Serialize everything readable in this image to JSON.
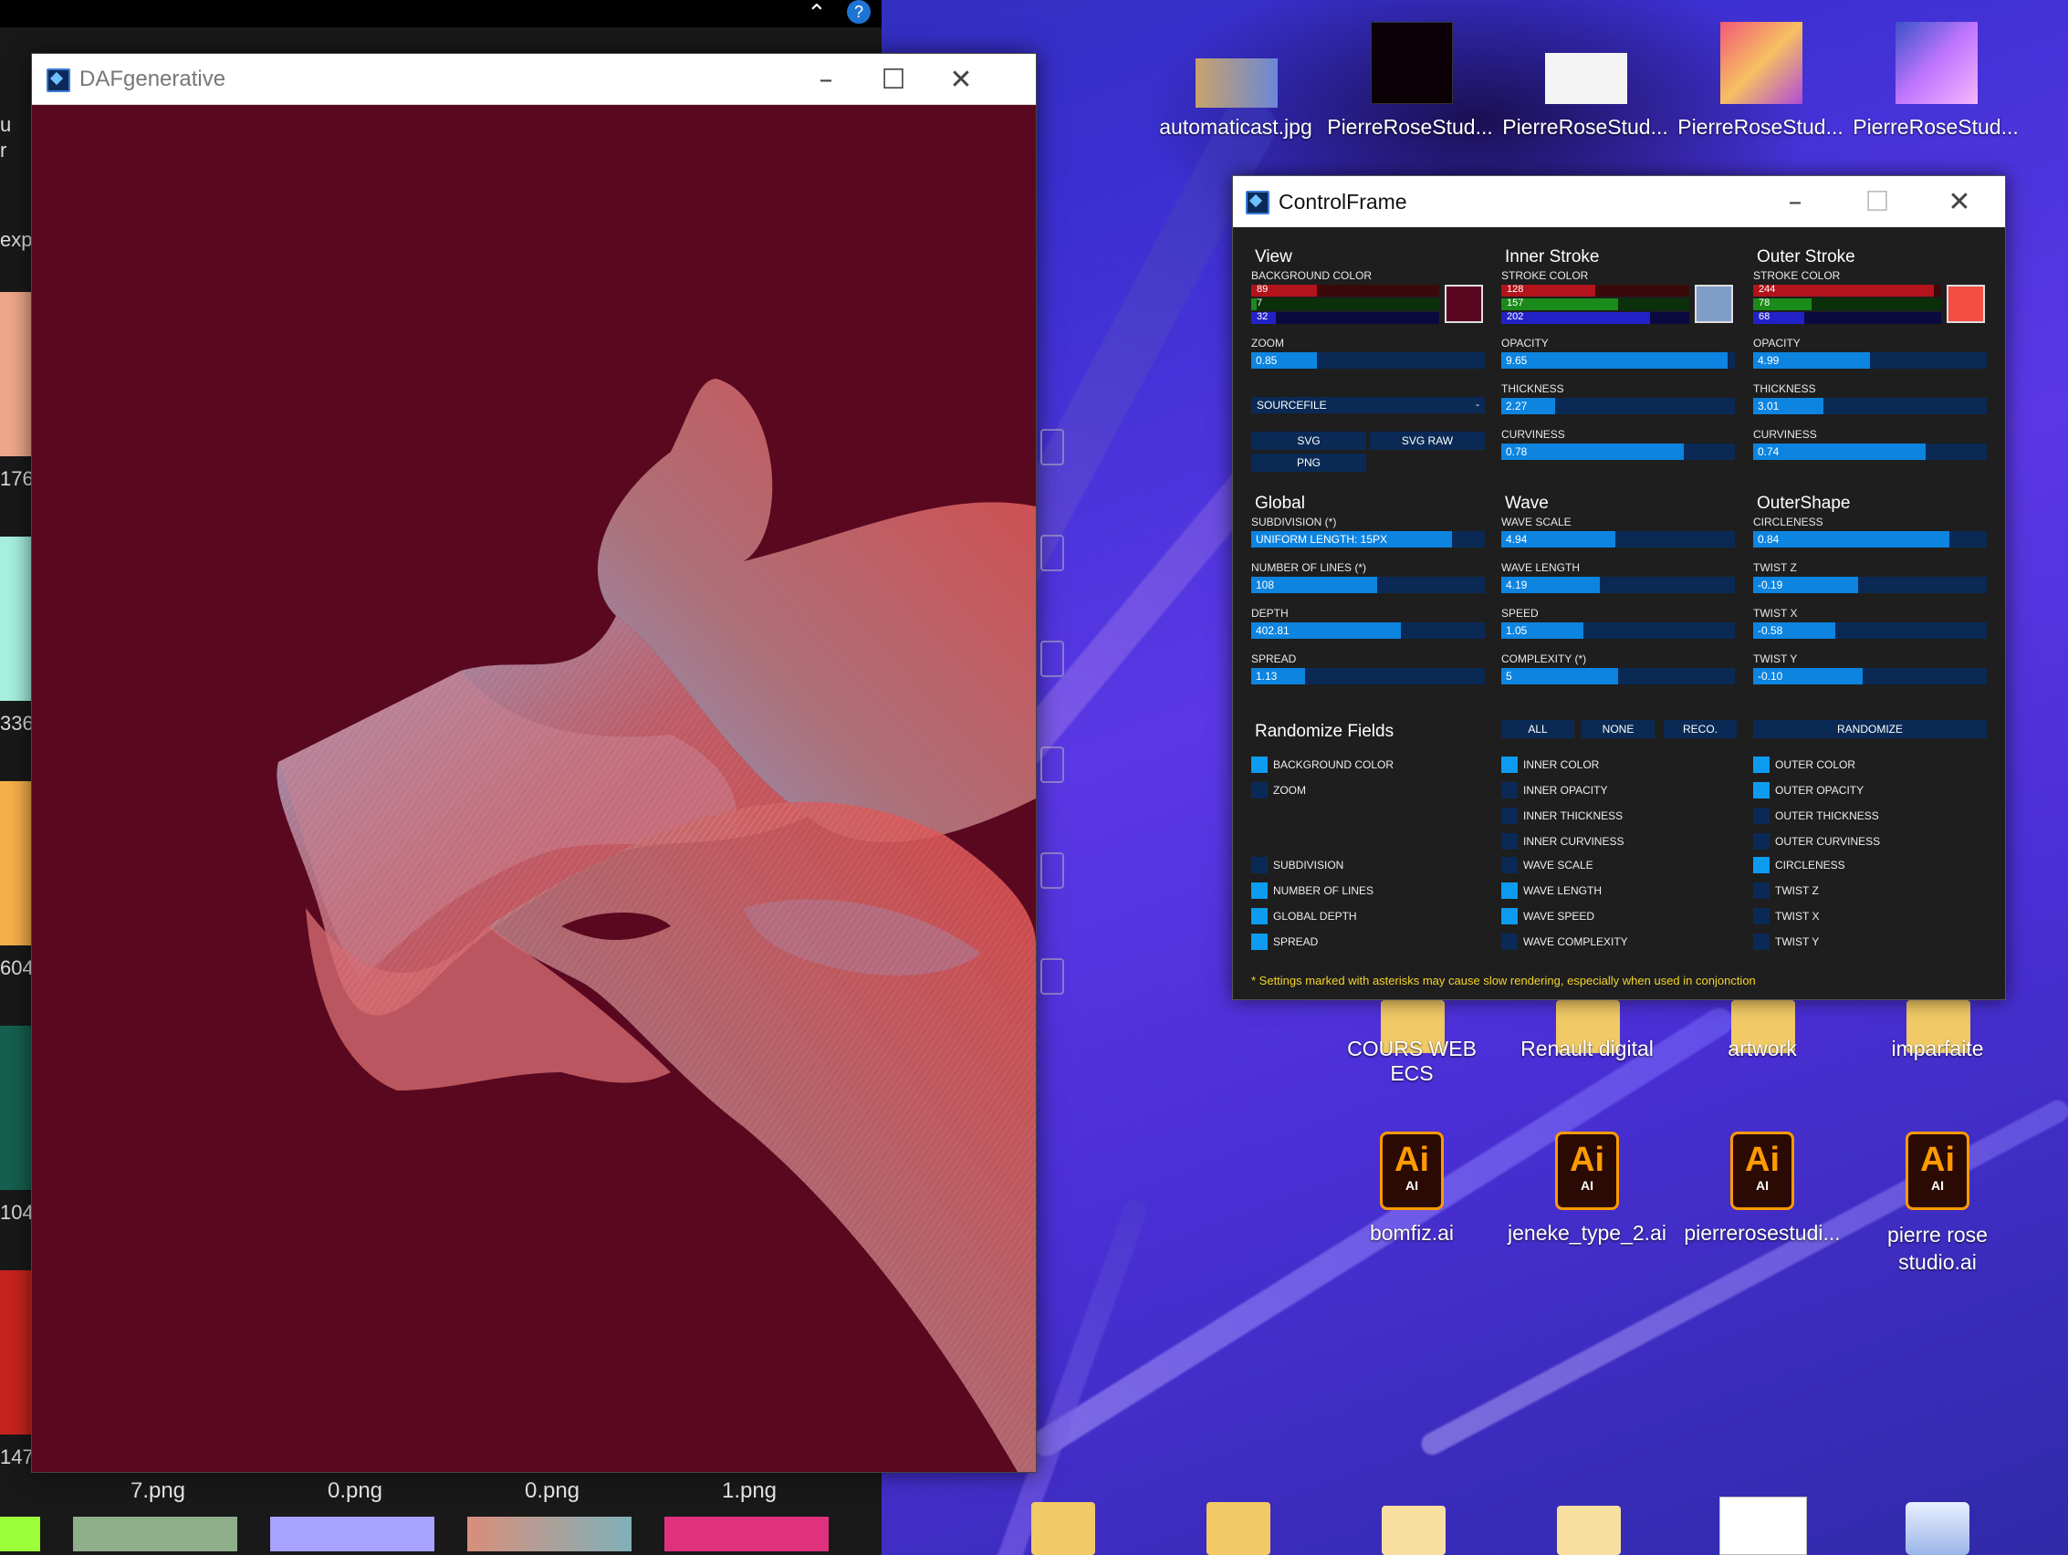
{
  "explorer": {
    "side_labels": [
      "u",
      "r",
      "exp",
      "176",
      "336",
      "604",
      "104",
      "147"
    ],
    "bottom_files": [
      "7.png",
      "0.png",
      "0.png",
      "1.png"
    ]
  },
  "daf_window": {
    "title": "DAFgenerative",
    "background_color": "#5a0820"
  },
  "desktop": {
    "top_icons": [
      "automaticast.jpg",
      "PierreRoseStud...",
      "PierreRoseStud...",
      "PierreRoseStud...",
      "PierreRoseStud..."
    ],
    "folder_icons": [
      "COURS WEB ECS",
      "Renault digital",
      "artwork",
      "imparfaite"
    ],
    "ai_icons": [
      "bomfiz.ai",
      "jeneke_type_2.ai",
      "pierrerosestudi...",
      "pierre rose studio.ai"
    ],
    "ai_badge": "Ai",
    "ai_sub": "AI"
  },
  "control_frame": {
    "title": "ControlFrame",
    "view": {
      "heading": "View",
      "bg_label": "BACKGROUND COLOR",
      "r": "89",
      "g": "7",
      "b": "32",
      "r_level": 0.35,
      "g_level": 0.03,
      "b_level": 0.13,
      "swatch": "#590720",
      "zoom_label": "ZOOM",
      "zoom": "0.85",
      "zoom_level": 0.28,
      "sourcefile": "SOURCEFILE",
      "sourcefile_arrow": "-",
      "svg": "SVG",
      "svg_raw": "SVG RAW",
      "png": "PNG"
    },
    "inner": {
      "heading": "Inner Stroke",
      "color_label": "STROKE COLOR",
      "r": "128",
      "g": "157",
      "b": "202",
      "r_level": 0.5,
      "g_level": 0.62,
      "b_level": 0.79,
      "swatch": "#809dca",
      "opacity_label": "OPACITY",
      "opacity": "9.65",
      "opacity_level": 0.97,
      "thickness_label": "THICKNESS",
      "thickness": "2.27",
      "thickness_level": 0.23,
      "curviness_label": "CURVINESS",
      "curviness": "0.78",
      "curviness_level": 0.78
    },
    "outer": {
      "heading": "Outer Stroke",
      "color_label": "STROKE COLOR",
      "r": "244",
      "g": "78",
      "b": "68",
      "r_level": 0.96,
      "g_level": 0.31,
      "b_level": 0.27,
      "swatch": "#f44e44",
      "opacity_label": "OPACITY",
      "opacity": "4.99",
      "opacity_level": 0.5,
      "thickness_label": "THICKNESS",
      "thickness": "3.01",
      "thickness_level": 0.3,
      "curviness_label": "CURVINESS",
      "curviness": "0.74",
      "curviness_level": 0.74
    },
    "global": {
      "heading": "Global",
      "subdivision_label": "SUBDIVISION (*)",
      "subdivision": "UNIFORM LENGTH: 15PX",
      "subdivision_level": 0.86,
      "lines_label": "NUMBER OF LINES (*)",
      "lines": "108",
      "lines_level": 0.54,
      "depth_label": "DEPTH",
      "depth": "402.81",
      "depth_level": 0.64,
      "spread_label": "SPREAD",
      "spread": "1.13",
      "spread_level": 0.23
    },
    "wave": {
      "heading": "Wave",
      "scale_label": "WAVE SCALE",
      "scale": "4.94",
      "scale_level": 0.49,
      "length_label": "WAVE LENGTH",
      "length": "4.19",
      "length_level": 0.42,
      "speed_label": "SPEED",
      "speed": "1.05",
      "speed_level": 0.35,
      "complexity_label": "COMPLEXITY (*)",
      "complexity": "5",
      "complexity_level": 0.5
    },
    "outershape": {
      "heading": "OuterShape",
      "circleness_label": "CIRCLENESS",
      "circleness": "0.84",
      "circleness_level": 0.84,
      "twistz_label": "TWIST Z",
      "twistz": "-0.19",
      "twistz_level": 0.45,
      "twistx_label": "TWIST X",
      "twistx": "-0.58",
      "twistx_level": 0.35,
      "twisty_label": "TWIST Y",
      "twisty": "-0.10",
      "twisty_level": 0.47
    },
    "randomize": {
      "heading": "Randomize Fields",
      "all": "ALL",
      "none": "NONE",
      "reco": "RECO.",
      "randomize": "RANDOMIZE",
      "col1": [
        {
          "label": "BACKGROUND COLOR",
          "on": true
        },
        {
          "label": "ZOOM",
          "on": false
        },
        {
          "label": "SUBDIVISION",
          "on": false
        },
        {
          "label": "NUMBER OF LINES",
          "on": true
        },
        {
          "label": "GLOBAL DEPTH",
          "on": true
        },
        {
          "label": "SPREAD",
          "on": true
        }
      ],
      "col2": [
        {
          "label": "INNER COLOR",
          "on": true
        },
        {
          "label": "INNER OPACITY",
          "on": false
        },
        {
          "label": "INNER THICKNESS",
          "on": false
        },
        {
          "label": "INNER CURVINESS",
          "on": false
        },
        {
          "label": "WAVE SCALE",
          "on": false
        },
        {
          "label": "WAVE LENGTH",
          "on": true
        },
        {
          "label": "WAVE SPEED",
          "on": true
        },
        {
          "label": "WAVE COMPLEXITY",
          "on": false
        }
      ],
      "col3": [
        {
          "label": "OUTER COLOR",
          "on": true
        },
        {
          "label": "OUTER OPACITY",
          "on": true
        },
        {
          "label": "OUTER THICKNESS",
          "on": false
        },
        {
          "label": "OUTER CURVINESS",
          "on": false
        },
        {
          "label": "CIRCLENESS",
          "on": true
        },
        {
          "label": "TWIST Z",
          "on": false
        },
        {
          "label": "TWIST X",
          "on": false
        },
        {
          "label": "TWIST Y",
          "on": false
        }
      ]
    },
    "note": "* Settings marked with asterisks may cause slow rendering, especially when used in conjonction"
  }
}
